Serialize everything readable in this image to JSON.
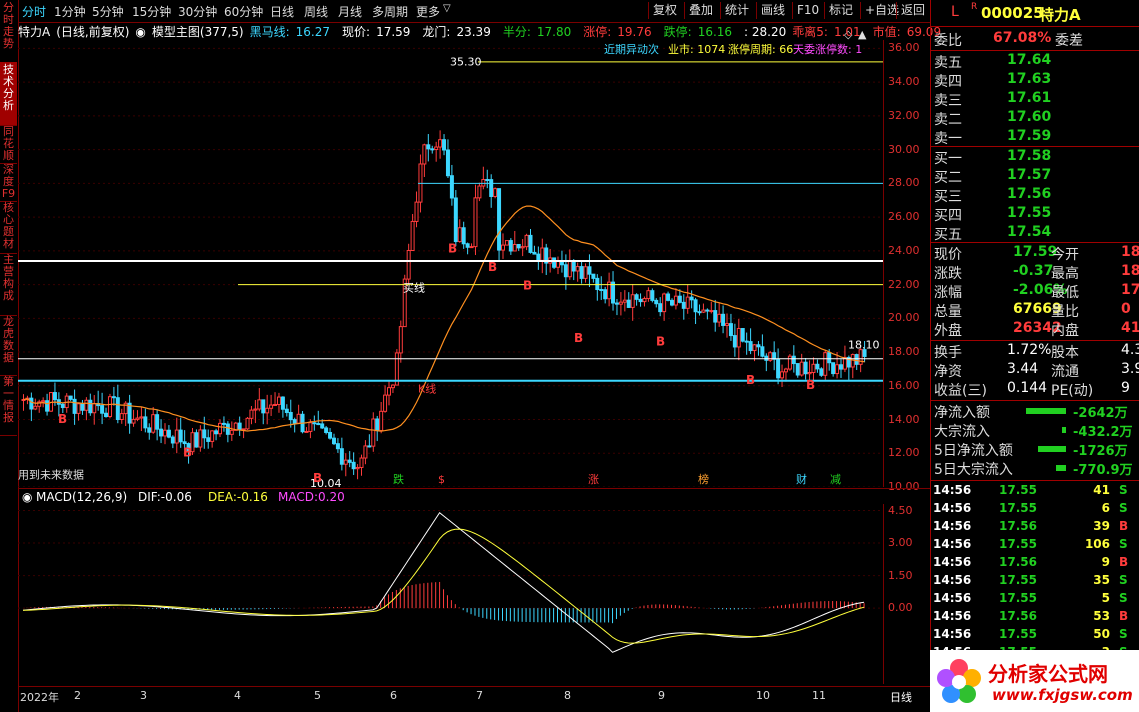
{
  "left_tabs": [
    {
      "label": "分时走势",
      "active": false
    },
    {
      "label": "技术分析",
      "active": true
    },
    {
      "label": "同花顺",
      "active": false
    },
    {
      "label": "深度F9",
      "active": false
    },
    {
      "label": "核心题材",
      "active": false
    },
    {
      "label": "主营构成",
      "active": false
    },
    {
      "label": "龙虎数据",
      "active": false
    },
    {
      "label": "第一情报",
      "active": false
    }
  ],
  "menu": {
    "periods": [
      "分时",
      "1分钟",
      "5分钟",
      "15分钟",
      "30分钟",
      "60分钟",
      "日线",
      "周线",
      "月线",
      "多周期",
      "更多"
    ],
    "active": "分时",
    "more_arrow": "▽",
    "right_buttons": [
      "复权",
      "叠加",
      "统计",
      "画线",
      "F10",
      "标记",
      "+自选",
      "返回"
    ],
    "diamond": "◇",
    "triangle_up": "▲"
  },
  "info": {
    "stock": "特力A",
    "adjust": "(日线,前复权)",
    "indicator": "模型主图(377,5)",
    "heima_label": "黑马线:",
    "heima": "16.27",
    "xianjia_label": "现价:",
    "xianjia": "17.59",
    "longmen_label": "龙门:",
    "longmen": "23.39",
    "banfen_label": "半分:",
    "banfen": "17.80",
    "zhangting_label": "涨停:",
    "zhangting": "19.76",
    "dieting_label": "跌停:",
    "dieting": "16.16",
    "colon_val": ": 28.20",
    "guaili_label": "乖离5:",
    "guaili": "1.01",
    "shizhi_label": "市值:",
    "shizhi": "69.09"
  },
  "info2": {
    "text1": "近期异动次",
    "text2": "业市: 1074",
    "text3": "涨停周期: 66",
    "text4": "天委涨停数: 1"
  },
  "price_axis": [
    "36.00",
    "34.00",
    "32.00",
    "30.00",
    "28.00",
    "26.00",
    "24.00",
    "22.00",
    "20.00",
    "18.00",
    "16.00",
    "14.00",
    "12.00",
    "10.00"
  ],
  "annotations": {
    "high": "35.30",
    "low": "10.04",
    "last": "18.10",
    "future_note": "用到未来数据",
    "line1": "买线",
    "kline_label": "K线",
    "events": [
      "跌",
      "$",
      "涨",
      "榜",
      "财",
      "减"
    ]
  },
  "macd": {
    "title": "MACD(12,26,9)",
    "dif_label": "DIF:",
    "dif": "-0.06",
    "dea_label": "DEA:",
    "dea": "-0.16",
    "macd_label": "MACD:",
    "macd_val": "0.20",
    "axis": [
      "4.50",
      "3.00",
      "1.50",
      "0.00"
    ]
  },
  "time_axis": {
    "labels": [
      "2022年",
      "2",
      "3",
      "4",
      "5",
      "6",
      "7",
      "8",
      "9",
      "10",
      "11"
    ],
    "right": "日线"
  },
  "quote": {
    "l_badge": "L",
    "r_badge": "R",
    "code": "000025",
    "name": "特力A",
    "weibi_label": "委比",
    "weibi": "67.08%",
    "weicha_label": "委差",
    "asks": [
      {
        "label": "卖五",
        "price": "17.64"
      },
      {
        "label": "卖四",
        "price": "17.63"
      },
      {
        "label": "卖三",
        "price": "17.61"
      },
      {
        "label": "卖二",
        "price": "17.60"
      },
      {
        "label": "卖一",
        "price": "17.59"
      }
    ],
    "bids": [
      {
        "label": "买一",
        "price": "17.58"
      },
      {
        "label": "买二",
        "price": "17.57"
      },
      {
        "label": "买三",
        "price": "17.56"
      },
      {
        "label": "买四",
        "price": "17.55"
      },
      {
        "label": "买五",
        "price": "17.54"
      }
    ],
    "stats": [
      {
        "l1": "现价",
        "v1": "17.59",
        "c1": "green",
        "l2": "今开",
        "v2": "18"
      },
      {
        "l1": "涨跌",
        "v1": "-0.37",
        "c1": "green",
        "l2": "最高",
        "v2": "18"
      },
      {
        "l1": "涨幅",
        "v1": "-2.06%",
        "c1": "green",
        "l2": "最低",
        "v2": "17"
      },
      {
        "l1": "总量",
        "v1": "67669",
        "c1": "yellow",
        "l2": "量比",
        "v2": "0"
      },
      {
        "l1": "外盘",
        "v1": "26342",
        "c1": "red",
        "l2": "内盘",
        "v2": "41"
      }
    ],
    "stats2": [
      {
        "l1": "换手",
        "v1": "1.72%",
        "l2": "股本",
        "v2": "4.3"
      },
      {
        "l1": "净资",
        "v1": "3.44",
        "l2": "流通",
        "v2": "3.9"
      },
      {
        "l1": "收益(三)",
        "v1": "0.144",
        "l2": "PE(动)",
        "v2": "9"
      }
    ],
    "flows": [
      {
        "label": "净流入额",
        "value": "-2642万",
        "bar": 40
      },
      {
        "label": "大宗流入",
        "value": "-432.2万",
        "bar": 4
      },
      {
        "label": "5日净流入额",
        "value": "-1726万",
        "bar": 28
      },
      {
        "label": "5日大宗流入",
        "value": "-770.9万",
        "bar": 10
      }
    ],
    "ticks": [
      {
        "t": "14:56",
        "p": "17.55",
        "v": "41",
        "s": "S"
      },
      {
        "t": "14:56",
        "p": "17.55",
        "v": "6",
        "s": "S"
      },
      {
        "t": "14:56",
        "p": "17.56",
        "v": "39",
        "s": "B"
      },
      {
        "t": "14:56",
        "p": "17.55",
        "v": "106",
        "s": "S"
      },
      {
        "t": "14:56",
        "p": "17.56",
        "v": "9",
        "s": "B"
      },
      {
        "t": "14:56",
        "p": "17.55",
        "v": "35",
        "s": "S"
      },
      {
        "t": "14:56",
        "p": "17.55",
        "v": "5",
        "s": "S"
      },
      {
        "t": "14:56",
        "p": "17.56",
        "v": "53",
        "s": "B"
      },
      {
        "t": "14:56",
        "p": "17.55",
        "v": "50",
        "s": "S"
      },
      {
        "t": "14:56",
        "p": "17.55",
        "v": "3",
        "s": "S"
      }
    ]
  },
  "logo": {
    "text": "分析家公式网",
    "url": "www.fxjgsw.com"
  },
  "chart_data": {
    "type": "candlestick",
    "ylim": [
      10,
      36.5
    ],
    "x": [
      "2022-01",
      "2022-02",
      "2022-03",
      "2022-04",
      "2022-05",
      "2022-06",
      "2022-07",
      "2022-08",
      "2022-09",
      "2022-10",
      "2022-11"
    ],
    "close_by_month": [
      15.2,
      14.8,
      12.6,
      15.0,
      11.2,
      25.0,
      24.5,
      21.5,
      20.5,
      17.0,
      17.6
    ],
    "high": 35.3,
    "low": 10.04,
    "macd_ylim": [
      -3.5,
      4.8
    ]
  }
}
